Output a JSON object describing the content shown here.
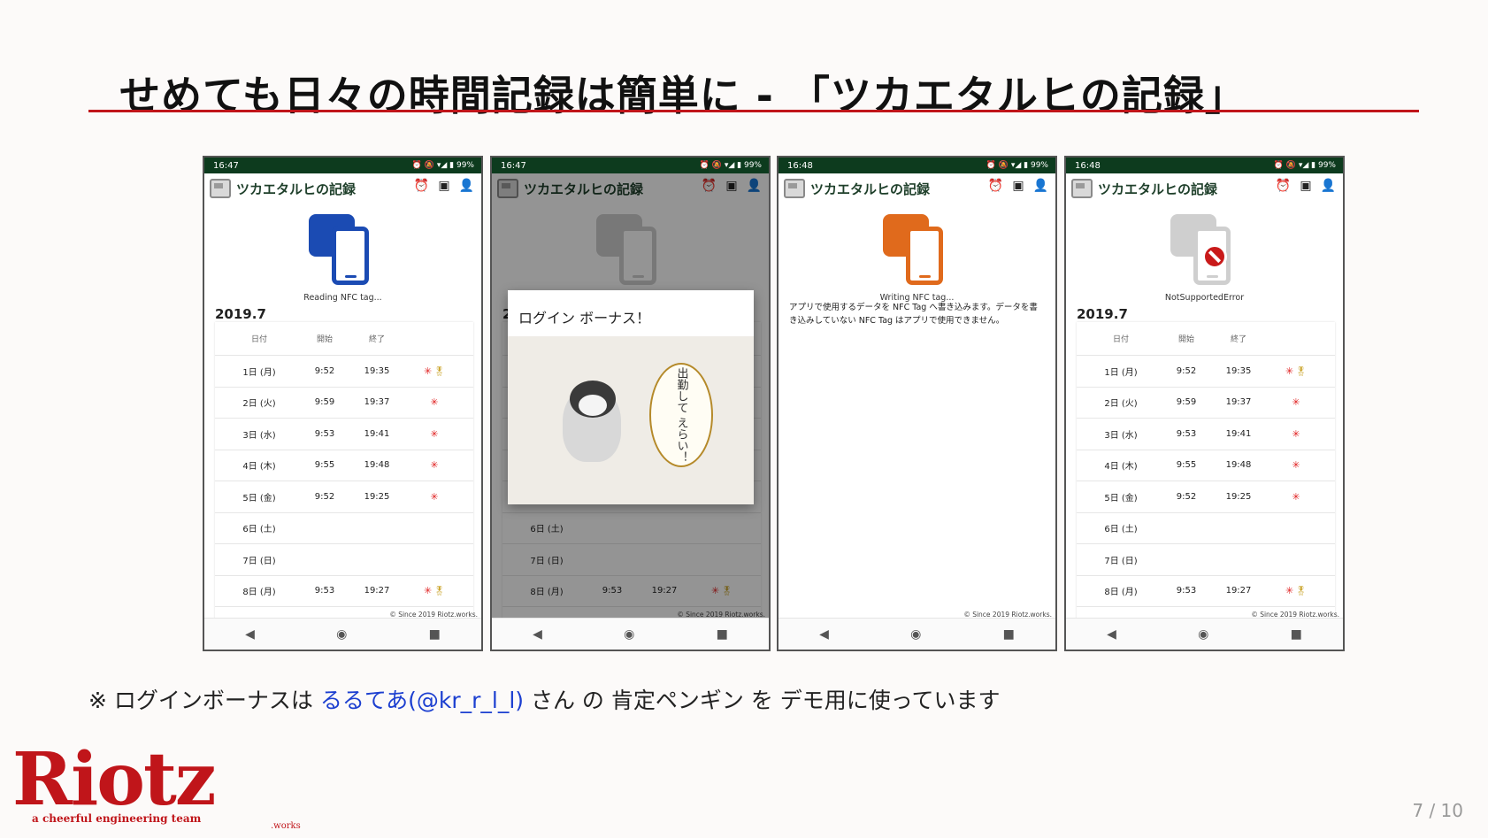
{
  "slide": {
    "title": "せめても日々の時間記録は簡単に - 「ツカエタルヒの記録」",
    "footnote_pre": "※ ログインボーナスは ",
    "footnote_link": "るるてあ(@kr_r_l_l)",
    "footnote_post": " さん の 肯定ペンギン を デモ用に使っています",
    "page_number": "7 / 10"
  },
  "logo": {
    "word": "Riotz",
    "tagline": "a cheerful engineering team",
    "suffix": ".works"
  },
  "app": {
    "title": "ツカエタルヒの記録",
    "footer": "© Since 2019 Riotz.works.",
    "status_right": "⏰ 🔕 ▾◢ ▮ 99%",
    "month": "2019.7",
    "headers": [
      "日付",
      "開始",
      "終了"
    ],
    "rows": [
      {
        "date": "1日 (月)",
        "start": "9:52",
        "end": "19:35",
        "mark": "✳",
        "medal": "🎖"
      },
      {
        "date": "2日 (火)",
        "start": "9:59",
        "end": "19:37",
        "mark": "✳",
        "medal": ""
      },
      {
        "date": "3日 (水)",
        "start": "9:53",
        "end": "19:41",
        "mark": "✳",
        "medal": ""
      },
      {
        "date": "4日 (木)",
        "start": "9:55",
        "end": "19:48",
        "mark": "✳",
        "medal": ""
      },
      {
        "date": "5日 (金)",
        "start": "9:52",
        "end": "19:25",
        "mark": "✳",
        "medal": ""
      },
      {
        "date": "6日 (土)",
        "start": "",
        "end": "",
        "mark": "",
        "medal": ""
      },
      {
        "date": "7日 (日)",
        "start": "",
        "end": "",
        "mark": "",
        "medal": ""
      },
      {
        "date": "8日 (月)",
        "start": "9:53",
        "end": "19:27",
        "mark": "✳",
        "medal": "🎖"
      }
    ]
  },
  "phones": [
    {
      "time": "16:47",
      "caption": "Reading NFC tag...",
      "icon": "nfc-read-icon",
      "color": "#1b4bb3"
    },
    {
      "time": "16:47",
      "dialog_title": "ログイン ボーナス！",
      "speech": "出勤して えらい！",
      "icon": "nfc-dim-icon"
    },
    {
      "time": "16:48",
      "caption": "Writing NFC tag...",
      "icon": "nfc-write-icon",
      "color": "#e06a1c",
      "message": "アプリで使用するデータを NFC Tag へ書き込みます。データを書き込みしていない NFC Tag はアプリで使用できません。"
    },
    {
      "time": "16:48",
      "caption": "NotSupportedError",
      "icon": "nfc-unsupported-icon",
      "color": "#cfcfcf"
    }
  ],
  "colors": {
    "accent": "#c0151a",
    "status_bar": "#0d3b1e",
    "link": "#1c3fd0"
  }
}
